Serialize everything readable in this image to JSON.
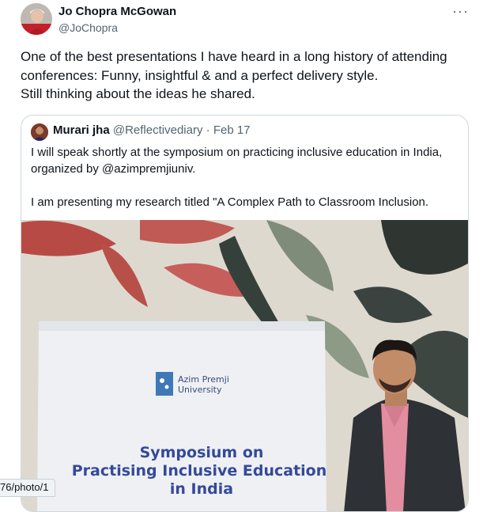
{
  "tweet": {
    "author_name": "Jo Chopra McGowan",
    "author_handle": "@JoChopra",
    "more_label": "···",
    "text": "One of the best presentations I have heard in a long history of attending conferences: Funny, insightful & and a perfect delivery style.\nStill thinking about the ideas he shared."
  },
  "quoted": {
    "author_name": "Murari jha",
    "author_handle": "@Reflectivediary",
    "separator": "·",
    "date": "Feb 17",
    "paragraph_1": "I will speak shortly at the symposium on practicing inclusive education in India, organized by @azimpremjiuniv.",
    "paragraph_2": "I am presenting my research titled \"A Complex Path to Classroom Inclusion."
  },
  "photo": {
    "university_line1": "Azim Premji",
    "university_line2": "University",
    "title_line1": "Symposium on",
    "title_line2": "Practising Inclusive Education",
    "title_line3": "in India"
  },
  "status_url": "76/photo/1",
  "colors": {
    "text_primary": "#0f1419",
    "text_secondary": "#536471",
    "border": "#cfd9de",
    "poster_title": "#34499a"
  },
  "icons": {
    "more": "ellipsis-icon"
  }
}
